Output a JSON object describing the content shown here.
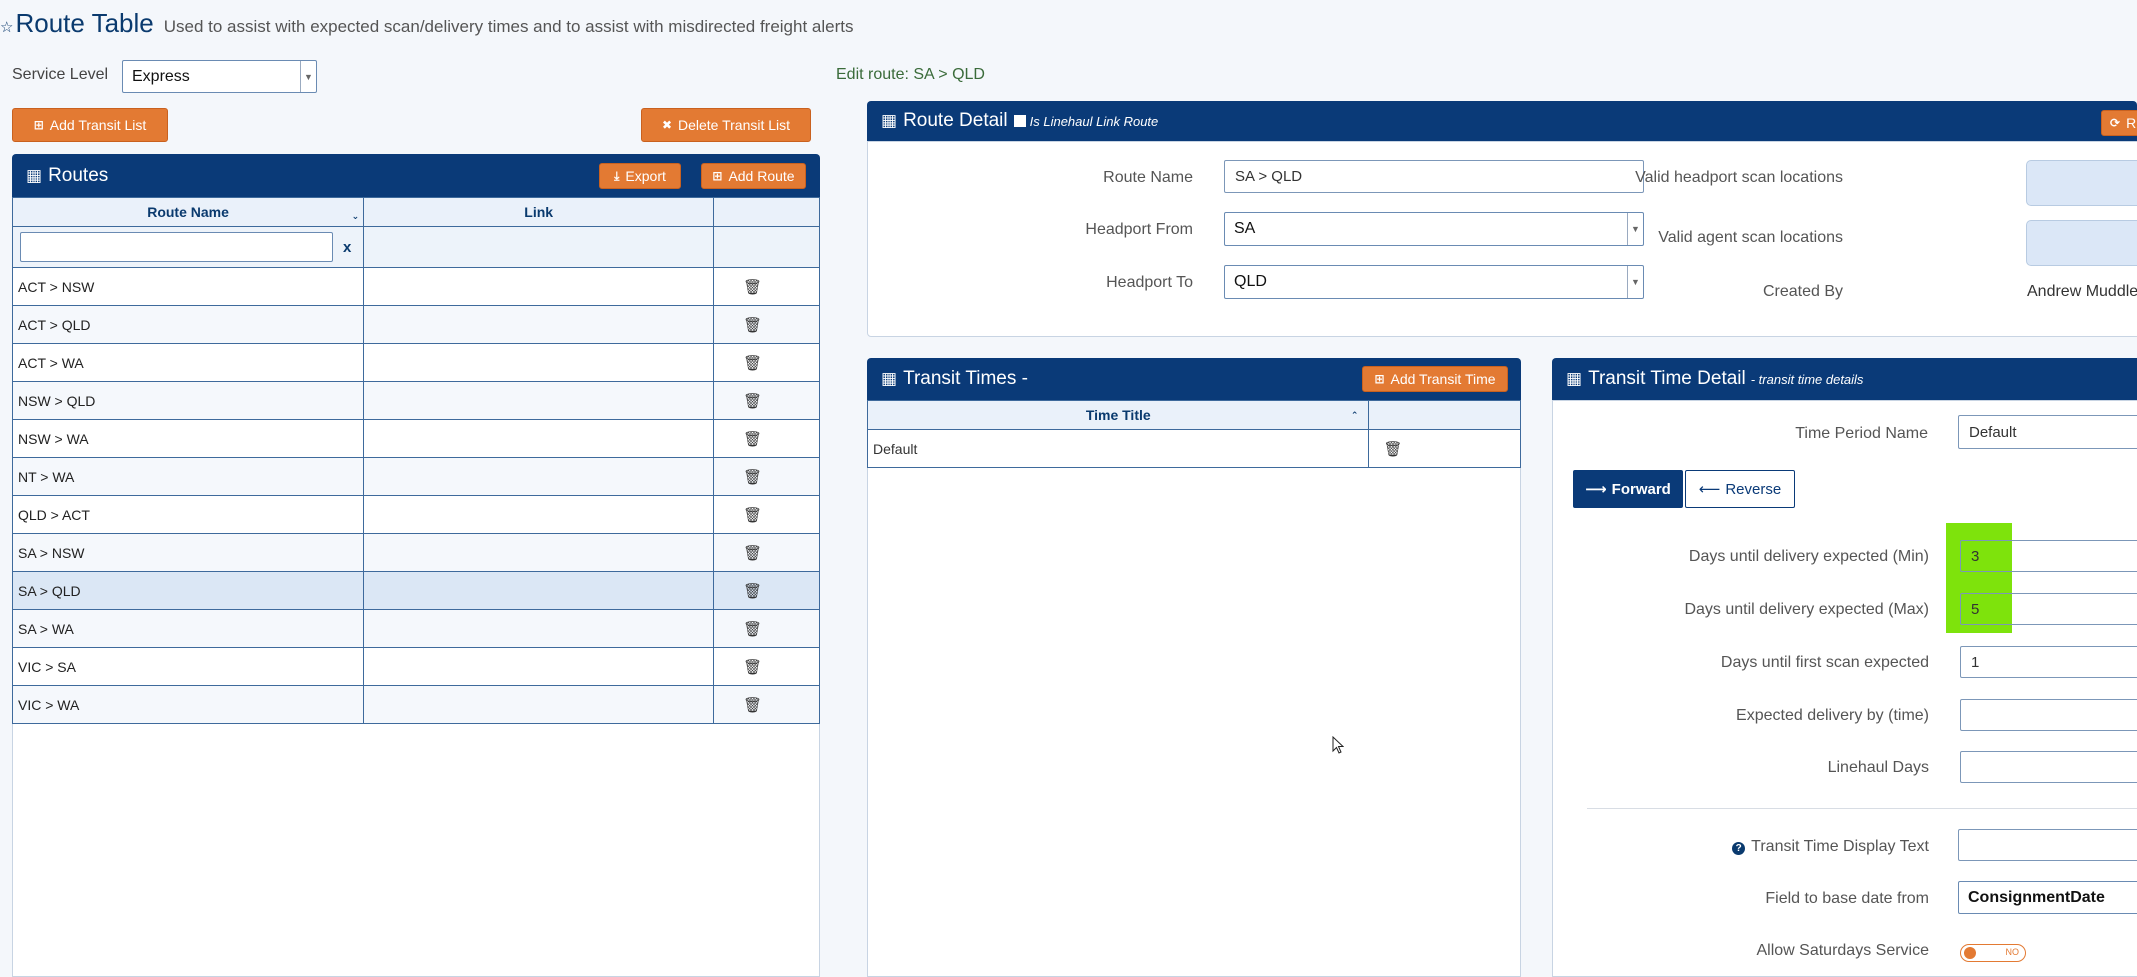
{
  "header": {
    "title": "Route Table",
    "subtitle": "Used to assist with expected scan/delivery times and to assist with misdirected freight alerts"
  },
  "service_level": {
    "label": "Service Level",
    "value": "Express"
  },
  "edit_route": "Edit route: SA > QLD",
  "buttons": {
    "add_transit_list": "Add Transit List",
    "delete_transit_list": "Delete Transit List",
    "export": "Export",
    "add_route": "Add Route",
    "add_transit_time": "Add Transit Time",
    "refresh_partial": "R"
  },
  "routes_panel": {
    "title": "Routes",
    "columns": [
      "Route Name",
      "Link",
      ""
    ],
    "filter_clear": "x",
    "rows": [
      {
        "name": "ACT > NSW",
        "link": ""
      },
      {
        "name": "ACT > QLD",
        "link": ""
      },
      {
        "name": "ACT > WA",
        "link": ""
      },
      {
        "name": "NSW > QLD",
        "link": ""
      },
      {
        "name": "NSW > WA",
        "link": ""
      },
      {
        "name": "NT > WA",
        "link": ""
      },
      {
        "name": "QLD > ACT",
        "link": ""
      },
      {
        "name": "SA > NSW",
        "link": ""
      },
      {
        "name": "SA > QLD",
        "link": ""
      },
      {
        "name": "SA > WA",
        "link": ""
      },
      {
        "name": "VIC > SA",
        "link": ""
      },
      {
        "name": "VIC > WA",
        "link": ""
      }
    ],
    "selected_index": 8
  },
  "route_detail": {
    "title": "Route Detail",
    "linehaul_label": "Is Linehaul Link Route",
    "route_name_label": "Route Name",
    "route_name_value": "SA > QLD",
    "headport_from_label": "Headport From",
    "headport_from_value": "SA",
    "headport_to_label": "Headport To",
    "headport_to_value": "QLD",
    "valid_headport_label": "Valid headport scan locations",
    "valid_agent_label": "Valid agent scan locations",
    "created_by_label": "Created By",
    "created_by_value": "Andrew Muddle"
  },
  "transit_times": {
    "title": "Transit Times -",
    "column": "Time Title",
    "rows": [
      {
        "title": "Default"
      }
    ]
  },
  "transit_detail": {
    "title": "Transit Time Detail",
    "subtitle": "- transit time details",
    "time_period_label": "Time Period Name",
    "time_period_value": "Default",
    "tab_forward": "Forward",
    "tab_reverse": "Reverse",
    "min_label": "Days until delivery expected (Min)",
    "min_value": "3",
    "max_label": "Days until delivery expected (Max)",
    "max_value": "5",
    "first_scan_label": "Days until first scan expected",
    "first_scan_value": "1",
    "expected_by_label": "Expected delivery by (time)",
    "expected_by_value": "",
    "linehaul_days_label": "Linehaul Days",
    "linehaul_days_value": "",
    "display_text_label": "Transit Time Display Text",
    "display_text_value": "",
    "base_date_label": "Field to base date from",
    "base_date_value": "ConsignmentDate",
    "saturday_label": "Allow Saturdays Service",
    "saturday_toggle": "NO"
  },
  "colors": {
    "navy": "#0a3a78",
    "orange": "#e37a33",
    "highlight_green": "#7ee30c"
  }
}
